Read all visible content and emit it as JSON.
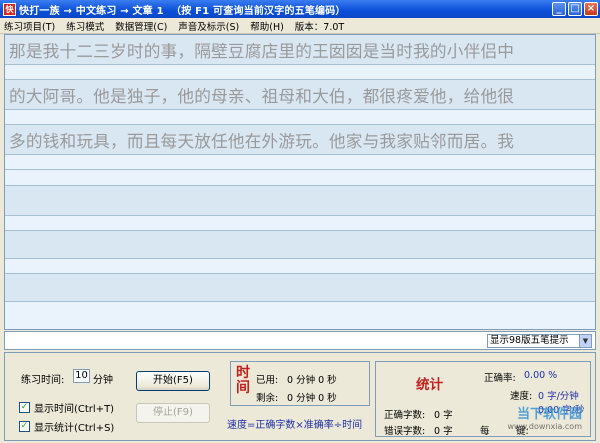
{
  "window": {
    "title": "快打一族 → 中文练习 → 文章 1  （按 F1 可查询当前汉字的五笔编码）",
    "app_icon_label": "快"
  },
  "menu": [
    {
      "label": "练习项目(T)"
    },
    {
      "label": "练习模式"
    },
    {
      "label": "数据管理(C)"
    },
    {
      "label": "声音及标示(S)"
    },
    {
      "label": "帮助(H)"
    },
    {
      "label": "版本：7.0T"
    }
  ],
  "practice_text": {
    "lines": [
      "那是我十二三岁时的事，隔壁豆腐店里的王囡囡是当时我的小伴侣中",
      "的大阿哥。他是独子，他的母亲、祖母和大伯，都很疼爱他，给他很",
      "多的钱和玩具，而且每天放任他在外游玩。他家与我家贴邻而居。我"
    ],
    "typed_lines": [
      "",
      "",
      "",
      "",
      ""
    ]
  },
  "hint_select": {
    "value": "显示98版五笔提示"
  },
  "controls": {
    "practice_time_label": "练习时间:",
    "practice_time_value": "10",
    "practice_time_unit": "分钟",
    "show_time_label": "显示时间(Ctrl+T)",
    "show_time_checked": true,
    "show_stats_label": "显示统计(Ctrl+S)",
    "show_stats_checked": true,
    "start_button": "开始(F5)",
    "stop_button": "停止(F9)"
  },
  "time_panel": {
    "heading": "时间",
    "used_label": "已用:",
    "used_value": "0 分钟 0 秒",
    "remaining_label": "剩余:",
    "remaining_value": "0 分钟 0 秒",
    "formula": "速度=正确字数×准确率÷时间"
  },
  "stats_panel": {
    "heading": "统计",
    "accuracy_label": "正确率:",
    "accuracy_value": "0.00 %",
    "speed_label": "速度:",
    "speed_value_1": "0 字/分钟",
    "speed_value_2": "0.00 字/秒",
    "correct_label": "正确字数:",
    "correct_value": "0 字",
    "error_label": "错误字数:",
    "error_value": "0 字",
    "keystroke_label": "每",
    "keystroke_suffix": "键:"
  },
  "watermark": {
    "logo": "当下软件园",
    "url": "www.downxia.com"
  },
  "icons": {
    "minimize": "minimize-icon",
    "maximize": "maximize-icon",
    "close": "close-icon",
    "dropdown": "chevron-down-icon",
    "check": "check-icon"
  },
  "colors": {
    "titlebar": "#0a4fd8",
    "text_row": "#d9e7f3",
    "type_row": "#eaf3fb",
    "heading_red": "#c3201e",
    "value_blue": "#1f2fa8"
  }
}
